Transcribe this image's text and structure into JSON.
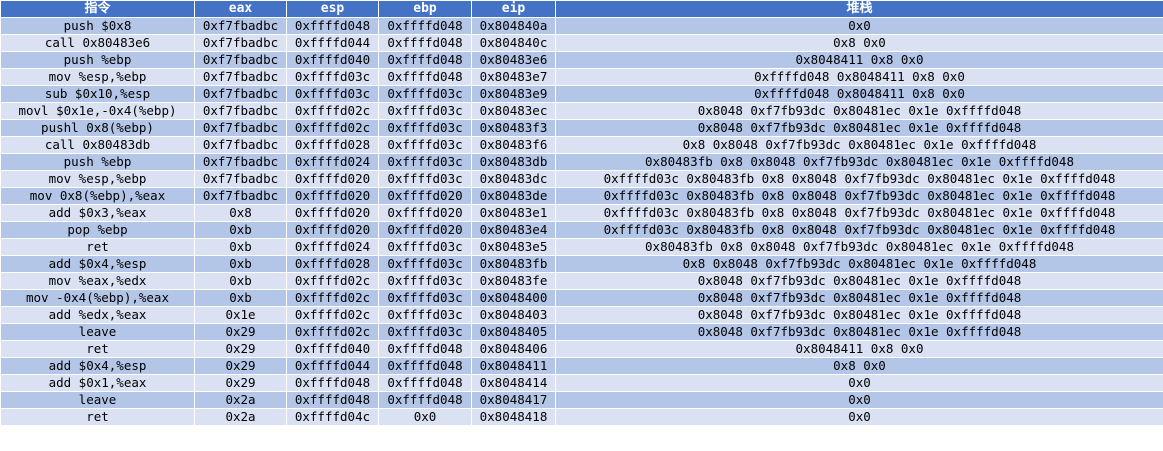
{
  "headers": [
    "指令",
    "eax",
    "esp",
    "ebp",
    "eip",
    "堆栈"
  ],
  "rows": [
    [
      "push $0x8",
      "0xf7fbadbc",
      "0xffffd048",
      "0xffffd048",
      "0x804840a",
      "0x0"
    ],
    [
      "call 0x80483e6",
      "0xf7fbadbc",
      "0xffffd044",
      "0xffffd048",
      "0x804840c",
      "0x8 0x0"
    ],
    [
      "push %ebp",
      "0xf7fbadbc",
      "0xffffd040",
      "0xffffd048",
      "0x80483e6",
      "0x8048411 0x8 0x0"
    ],
    [
      "mov %esp,%ebp",
      "0xf7fbadbc",
      "0xffffd03c",
      "0xffffd048",
      "0x80483e7",
      "0xffffd048 0x8048411 0x8 0x0"
    ],
    [
      "sub $0x10,%esp",
      "0xf7fbadbc",
      "0xffffd03c",
      "0xffffd03c",
      "0x80483e9",
      "0xffffd048 0x8048411 0x8 0x0"
    ],
    [
      "movl $0x1e,-0x4(%ebp)",
      "0xf7fbadbc",
      "0xffffd02c",
      "0xffffd03c",
      "0x80483ec",
      "0x8048 0xf7fb93dc 0x80481ec 0x1e 0xffffd048"
    ],
    [
      "pushl 0x8(%ebp)",
      "0xf7fbadbc",
      "0xffffd02c",
      "0xffffd03c",
      "0x80483f3",
      "0x8048 0xf7fb93dc 0x80481ec 0x1e 0xffffd048"
    ],
    [
      "call 0x80483db",
      "0xf7fbadbc",
      "0xffffd028",
      "0xffffd03c",
      "0x80483f6",
      "0x8 0x8048 0xf7fb93dc 0x80481ec 0x1e 0xffffd048"
    ],
    [
      "push %ebp",
      "0xf7fbadbc",
      "0xffffd024",
      "0xffffd03c",
      "0x80483db",
      "0x80483fb 0x8 0x8048 0xf7fb93dc 0x80481ec 0x1e 0xffffd048"
    ],
    [
      "mov %esp,%ebp",
      "0xf7fbadbc",
      "0xffffd020",
      "0xffffd03c",
      "0x80483dc",
      "0xffffd03c 0x80483fb 0x8 0x8048 0xf7fb93dc 0x80481ec 0x1e 0xffffd048"
    ],
    [
      "mov 0x8(%ebp),%eax",
      "0xf7fbadbc",
      "0xffffd020",
      "0xffffd020",
      "0x80483de",
      "0xffffd03c 0x80483fb 0x8 0x8048 0xf7fb93dc 0x80481ec 0x1e 0xffffd048"
    ],
    [
      "add $0x3,%eax",
      "0x8",
      "0xffffd020",
      "0xffffd020",
      "0x80483e1",
      "0xffffd03c 0x80483fb 0x8 0x8048 0xf7fb93dc 0x80481ec 0x1e 0xffffd048"
    ],
    [
      "pop %ebp",
      "0xb",
      "0xffffd020",
      "0xffffd020",
      "0x80483e4",
      "0xffffd03c 0x80483fb 0x8 0x8048 0xf7fb93dc 0x80481ec 0x1e 0xffffd048"
    ],
    [
      "ret",
      "0xb",
      "0xffffd024",
      "0xffffd03c",
      "0x80483e5",
      "0x80483fb 0x8 0x8048 0xf7fb93dc 0x80481ec 0x1e 0xffffd048"
    ],
    [
      "add $0x4,%esp",
      "0xb",
      "0xffffd028",
      "0xffffd03c",
      "0x80483fb",
      "0x8 0x8048 0xf7fb93dc 0x80481ec 0x1e 0xffffd048"
    ],
    [
      "mov %eax,%edx",
      "0xb",
      "0xffffd02c",
      "0xffffd03c",
      "0x80483fe",
      "0x8048 0xf7fb93dc 0x80481ec 0x1e 0xffffd048"
    ],
    [
      "mov -0x4(%ebp),%eax",
      "0xb",
      "0xffffd02c",
      "0xffffd03c",
      "0x8048400",
      "0x8048 0xf7fb93dc 0x80481ec 0x1e 0xffffd048"
    ],
    [
      "add %edx,%eax",
      "0x1e",
      "0xffffd02c",
      "0xffffd03c",
      "0x8048403",
      "0x8048 0xf7fb93dc 0x80481ec 0x1e 0xffffd048"
    ],
    [
      "leave",
      "0x29",
      "0xffffd02c",
      "0xffffd03c",
      "0x8048405",
      "0x8048 0xf7fb93dc 0x80481ec 0x1e 0xffffd048"
    ],
    [
      "ret",
      "0x29",
      "0xffffd040",
      "0xffffd048",
      "0x8048406",
      "0x8048411 0x8 0x0"
    ],
    [
      "add $0x4,%esp",
      "0x29",
      "0xffffd044",
      "0xffffd048",
      "0x8048411",
      "0x8 0x0"
    ],
    [
      "add $0x1,%eax",
      "0x29",
      "0xffffd048",
      "0xffffd048",
      "0x8048414",
      "0x0"
    ],
    [
      "leave",
      "0x2a",
      "0xffffd048",
      "0xffffd048",
      "0x8048417",
      "0x0"
    ],
    [
      "ret",
      "0x2a",
      "0xffffd04c",
      "0x0",
      "0x8048418",
      "0x0"
    ]
  ],
  "colors": {
    "header_bg": "#4472c4",
    "header_text": "#ffffff",
    "row_dark": "#b4c6e7",
    "row_light": "#d9e1f2"
  }
}
